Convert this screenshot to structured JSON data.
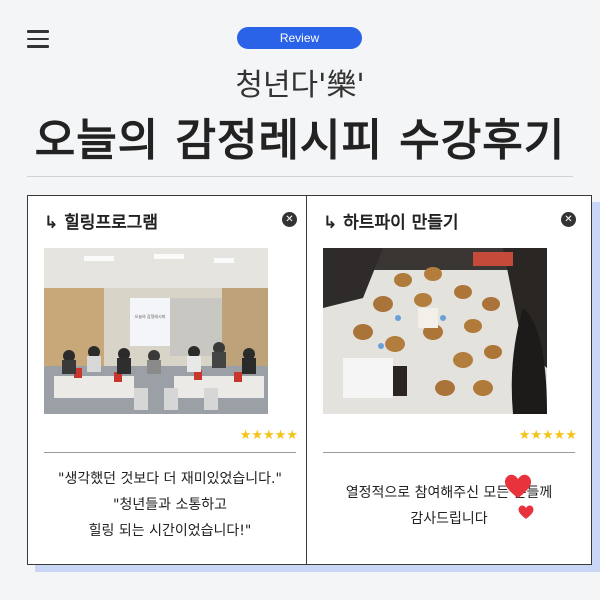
{
  "header": {
    "badge": "Review",
    "subtitle": "청년다'樂'",
    "title": "오늘의 감정레시피 수강후기"
  },
  "cards": [
    {
      "title": "↳ 힐링프로그램",
      "stars": "★★★★★",
      "rating": 5,
      "review_lines": [
        "\"생각했던 것보다 더 재미있었습니다.\"",
        "\"청년들과 소통하고",
        "힐링 되는 시간이었습니다!\""
      ],
      "photo_screen_text": "오늘의 감정레시피"
    },
    {
      "title": "↳ 하트파이 만들기",
      "stars": "★★★★★",
      "rating": 5,
      "review_lines": [
        "열정적으로 참여해주신 모든 분들께",
        "감사드립니다"
      ]
    }
  ],
  "colors": {
    "accent": "#2b63e8",
    "background": "#f4f5f7",
    "card_shadow": "#c9d6f6",
    "stars": "#f3c316",
    "heart": "#e8323c"
  }
}
